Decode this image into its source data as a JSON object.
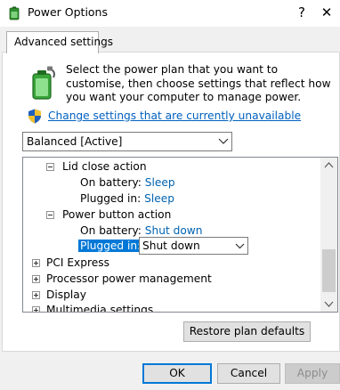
{
  "window": {
    "title": "Power Options",
    "help_glyph": "?",
    "close_glyph": "✕"
  },
  "tab": {
    "label": "Advanced settings"
  },
  "intro": {
    "text": "Select the power plan that you want to customise, then choose settings that reflect how you want your computer to manage power.",
    "change_settings_link": "Change settings that are currently unavailable"
  },
  "plan_select": {
    "value": "Balanced [Active]"
  },
  "tree": {
    "lid_close_action": "Lid close action",
    "lid_on_battery_label": "On battery:",
    "lid_on_battery_value": "Sleep",
    "lid_plugged_in_label": "Plugged in:",
    "lid_plugged_in_value": "Sleep",
    "power_button_action": "Power button action",
    "pb_on_battery_label": "On battery:",
    "pb_on_battery_value": "Shut down",
    "pb_plugged_in_label": "Plugged in:",
    "pb_plugged_in_select": "Shut down",
    "pci_express": "PCI Express",
    "processor_power_management": "Processor power management",
    "display": "Display",
    "multimedia_settings": "Multimedia settings"
  },
  "buttons": {
    "restore": "Restore plan defaults",
    "ok": "OK",
    "cancel": "Cancel",
    "apply": "Apply"
  },
  "colors": {
    "link": "#0060c0",
    "value": "#0063b1",
    "selection": "#0078d7",
    "ok_border": "#0078d7"
  },
  "icons": {
    "app": "power-options-icon",
    "header": "battery-plug-icon",
    "shield": "uac-shield-icon"
  }
}
